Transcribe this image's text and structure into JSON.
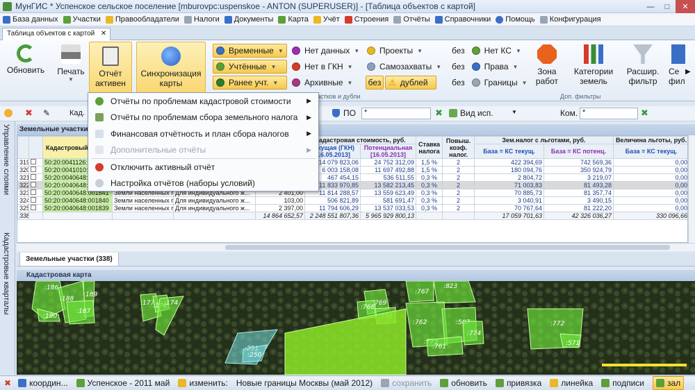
{
  "window": {
    "title": "МунГИС * Успенское сельское поселение   [mburovpc:uspenskoe - ANTON (SUPERUSER)] - [Таблица объектов с картой]"
  },
  "menu": [
    {
      "label": "База данных",
      "icon": "database-icon"
    },
    {
      "label": "Участки",
      "icon": "parcel-icon"
    },
    {
      "label": "Правообладатели",
      "icon": "owners-icon"
    },
    {
      "label": "Налоги",
      "icon": "tax-icon"
    },
    {
      "label": "Документы",
      "icon": "documents-icon"
    },
    {
      "label": "Карта",
      "icon": "map-icon"
    },
    {
      "label": "Учёт",
      "icon": "accounting-icon"
    },
    {
      "label": "Строения",
      "icon": "buildings-icon"
    },
    {
      "label": "Отчёты",
      "icon": "reports-icon"
    },
    {
      "label": "Справочники",
      "icon": "reference-icon"
    },
    {
      "label": "Помощь",
      "icon": "help-icon"
    },
    {
      "label": "Конфигурация",
      "icon": "config-icon"
    }
  ],
  "doc_tab": {
    "label": "Таблица объектов с картой"
  },
  "ribbon": {
    "refresh": "Обновить",
    "print": "Печать",
    "report_active": "Отчёт\nактивен",
    "sync_maps": "Синхронизация\nкарты",
    "col1": [
      "Временные",
      "Учтённые",
      "Ранее учт."
    ],
    "col2": [
      "Нет данных",
      "Нет в ГКН",
      "Архивные"
    ],
    "col3": [
      "Проекты",
      "Самозахваты"
    ],
    "dup_without": "без",
    "dup_label": "дублей",
    "col4_prefix": "без",
    "col4": [
      "Нет КС",
      "Права",
      "Границы"
    ],
    "zone": "Зона\nработ",
    "categories": "Категории\nземель",
    "ext_filter": "Расшир.\nфильтр",
    "partial": "Се\nфил",
    "group_dup": "астков и дубли",
    "group_extra": "Доп. фильтры"
  },
  "toolbar2": {
    "kad_label": "Кад.",
    "po_label": "ПО",
    "po_value": "*",
    "vid_label": "Вид исп.",
    "kom_label": "Ком.",
    "kom_value": "*"
  },
  "sidebar": {
    "tab1": "Управление слоями",
    "tab2": "Кадастровые кварталы"
  },
  "grid": {
    "title": "Земельные участки (338)",
    "headers": {
      "kad_num": "Кадастровый номер",
      "kad_cost": "Кадастровая стоимость, руб.",
      "cur_gkn": "Текущая (ГКН) [16.05.2013]",
      "potential": "Потенциальная [16.05.2013]",
      "rate": "Ставка налога",
      "coef": "Повыш. коэф. налог.",
      "zem_nalog": "Зем.налог с льготами, руб.",
      "base_ks": "База = КС текущ.",
      "base_ks_pot": "База = КС потенц.",
      "benefit": "Величина льготы, руб.",
      "benefit_base": "База = КС текущ."
    },
    "rows": [
      {
        "n": "319",
        "kad": "50:20:0041126:0",
        "cat": "",
        "use": "",
        "area": "",
        "cur": "14 079 823,06",
        "pot": "24 752 312,09",
        "rate": "1,5 %",
        "coef": "2",
        "tax": "422 394,69",
        "tax_pot": "742 569,36",
        "ben": "0,00"
      },
      {
        "n": "320",
        "kad": "50:20:0041010:0",
        "cat": "",
        "use": "",
        "area": "",
        "cur": "6 003 158,08",
        "pot": "11 697 492,88",
        "rate": "1,5 %",
        "coef": "2",
        "tax": "180 094,76",
        "tax_pot": "350 924,79",
        "ben": "0,00"
      },
      {
        "n": "321",
        "kad": "50:20:0040648:001844",
        "cat": "",
        "use": "",
        "area": "",
        "cur": "467 454,15",
        "pot": "536 511,55",
        "rate": "0,3 %",
        "coef": "2",
        "tax": "2 804,72",
        "tax_pot": "3 219,07",
        "ben": "0,00"
      },
      {
        "n": "322",
        "kad": "50:20:0040648:001843",
        "cat": "Земли населенных пунктов (земли насе...",
        "use": "Для индивидуального ж...",
        "area": "2 405,00",
        "cur": "11 833 970,85",
        "pot": "13 582 213,45",
        "rate": "0,3 %",
        "coef": "2",
        "tax": "71 003,83",
        "tax_pot": "81 493,28",
        "ben": "0,00"
      },
      {
        "n": "323",
        "kad": "50:20:0040648:001841",
        "cat": "Земли населенных пунктов (земли насе...",
        "use": "Для индивидуального ж...",
        "area": "2 401,00",
        "cur": "11 814 288,57",
        "pot": "13 559 623,49",
        "rate": "0,3 %",
        "coef": "2",
        "tax": "70 885,73",
        "tax_pot": "81 357,74",
        "ben": "0,00"
      },
      {
        "n": "324",
        "kad": "50:20:0040648:001840",
        "cat": "Земли населенных пунктов (земли насе...",
        "use": "Для индивидуального ж...",
        "area": "103,00",
        "cur": "506 821,89",
        "pot": "581 691,47",
        "rate": "0,3 %",
        "coef": "2",
        "tax": "3 040,91",
        "tax_pot": "3 490,15",
        "ben": "0,00"
      },
      {
        "n": "325",
        "kad": "50:20:0040648:001839",
        "cat": "Земли населенных пунктов (земли насе...",
        "use": "Для индивидуального ж...",
        "area": "2 397,00",
        "cur": "11 794 606,29",
        "pot": "13 537 033,53",
        "rate": "0,3 %",
        "coef": "2",
        "tax": "70 767,64",
        "tax_pot": "81 222,20",
        "ben": "0,00"
      }
    ],
    "totals": {
      "n": "338",
      "area": "14 864 652,57",
      "cur": "2 248 551 807,36",
      "pot": "5 965 929 800,13",
      "tax": "17 059 701,63",
      "tax_pot": "42 326 036,27",
      "ben": "330 096,66"
    }
  },
  "bottom_tab": "Земельные участки (338)",
  "map": {
    "title": "Кадастровая карта",
    "labels": [
      ":186",
      ":188",
      ":189",
      ":190",
      ":187",
      ":177",
      ":176",
      ":174",
      ":769",
      ":768",
      ":770",
      ":767",
      ":823",
      ":762",
      ":587",
      ":773",
      ":761",
      ":774",
      ":772",
      ":571",
      ":251",
      ":250"
    ]
  },
  "dropdown": [
    {
      "label": "Отчёты по проблемам кадастровой стоимости",
      "icon": "green-circle-icon",
      "submenu": true,
      "disabled": false
    },
    {
      "label": "Отчёты по проблемам сбора земельного налога",
      "icon": "report-icon",
      "submenu": true,
      "disabled": false
    },
    {
      "label": "Финансовая отчётность и план сбора налогов",
      "icon": "finance-icon",
      "submenu": true,
      "disabled": false
    },
    {
      "label": "Дополнительные отчёты",
      "icon": "extra-report-icon",
      "submenu": true,
      "disabled": true
    },
    {
      "label": "Отключить активный отчёт",
      "icon": "disable-icon",
      "submenu": false,
      "disabled": false
    },
    {
      "label": "Настройка отчётов (наборы условий)",
      "icon": "settings-icon",
      "submenu": false,
      "disabled": false
    }
  ],
  "status": {
    "coord": "координ...",
    "layer": "Успенское - 2011 май",
    "change": "изменить:",
    "boundaries": "Новые границы Москвы (май 2012)",
    "save": "сохранить",
    "update": "обновить",
    "snap": "привязка",
    "ruler": "линейка",
    "captions": "подписи",
    "fill": "зал"
  }
}
